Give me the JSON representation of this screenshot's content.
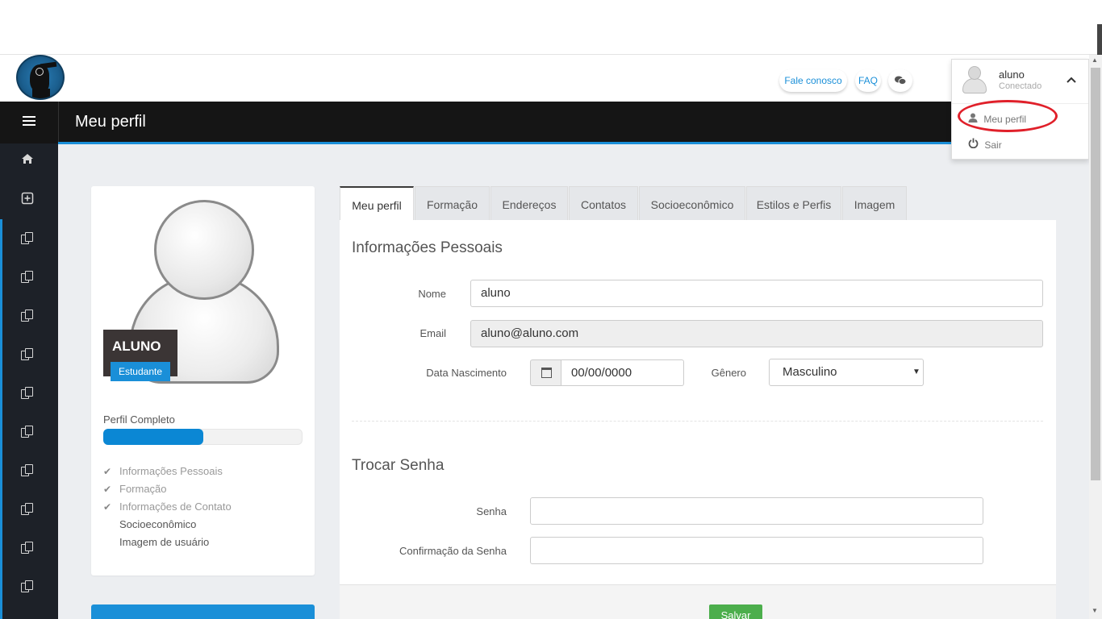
{
  "header": {
    "links": {
      "contact": "Fale conosco",
      "faq": "FAQ",
      "chat_icon": "chat-icon"
    }
  },
  "user_menu": {
    "name": "aluno",
    "status": "Conectado",
    "items": [
      {
        "label": "Meu perfil",
        "icon": "user-icon"
      },
      {
        "label": "Sair",
        "icon": "power-icon"
      }
    ],
    "highlight_color": "#e0202a"
  },
  "topbar": {
    "title": "Meu perfil"
  },
  "sidebar": {
    "icons": [
      "home-icon",
      "plus-square-icon",
      "copy-icon",
      "copy-icon",
      "copy-icon",
      "copy-icon",
      "copy-icon",
      "copy-icon",
      "copy-icon",
      "copy-icon",
      "copy-icon",
      "copy-icon"
    ]
  },
  "profile": {
    "name": "ALUNO",
    "role": "Estudante",
    "completion_label": "Perfil Completo",
    "completion_fraction": 0.5,
    "checklist": [
      {
        "label": "Informações Pessoais",
        "done": true
      },
      {
        "label": "Formação",
        "done": true
      },
      {
        "label": "Informações de Contato",
        "done": true
      },
      {
        "label": "Socioeconômico",
        "done": false
      },
      {
        "label": "Imagem de usuário",
        "done": false
      }
    ]
  },
  "tabs": [
    "Meu perfil",
    "Formação",
    "Endereços",
    "Contatos",
    "Socioeconômico",
    "Estilos e Perfis",
    "Imagem"
  ],
  "form": {
    "personal_title": "Informações Pessoais",
    "name_label": "Nome",
    "name_value": "aluno",
    "email_label": "Email",
    "email_value": "aluno@aluno.com",
    "birth_label": "Data Nascimento",
    "birth_value": "00/00/0000",
    "gender_label": "Gênero",
    "gender_value": "Masculino",
    "password_title": "Trocar Senha",
    "password_label": "Senha",
    "password_confirm_label": "Confirmação da Senha",
    "save_label": "Salvar"
  },
  "colors": {
    "accent": "#1a8fd8",
    "topbar": "#151515",
    "sidebar": "#1d2128",
    "save": "#4cae4c"
  }
}
